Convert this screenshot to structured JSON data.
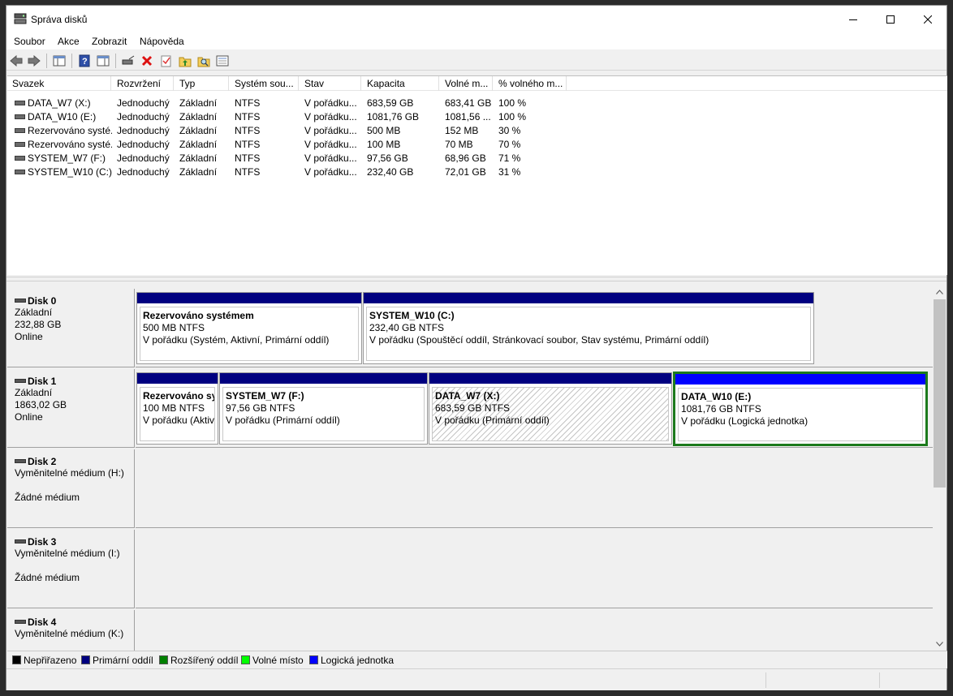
{
  "window": {
    "title": "Správa disků"
  },
  "menu": [
    "Soubor",
    "Akce",
    "Zobrazit",
    "Nápověda"
  ],
  "columns": [
    "Svazek",
    "Rozvržení",
    "Typ",
    "Systém sou...",
    "Stav",
    "Kapacita",
    "Volné m...",
    "% volného m..."
  ],
  "volumes": [
    [
      "DATA_W7 (X:)",
      "Jednoduchý",
      "Základní",
      "NTFS",
      "V pořádku...",
      "683,59 GB",
      "683,41 GB",
      "100 %"
    ],
    [
      "DATA_W10 (E:)",
      "Jednoduchý",
      "Základní",
      "NTFS",
      "V pořádku...",
      "1081,76 GB",
      "1081,56 ...",
      "100 %"
    ],
    [
      "Rezervováno systé...",
      "Jednoduchý",
      "Základní",
      "NTFS",
      "V pořádku...",
      "500 MB",
      "152 MB",
      "30 %"
    ],
    [
      "Rezervováno systé...",
      "Jednoduchý",
      "Základní",
      "NTFS",
      "V pořádku...",
      "100 MB",
      "70 MB",
      "70 %"
    ],
    [
      "SYSTEM_W7 (F:)",
      "Jednoduchý",
      "Základní",
      "NTFS",
      "V pořádku...",
      "97,56 GB",
      "68,96 GB",
      "71 %"
    ],
    [
      "SYSTEM_W10 (C:)",
      "Jednoduchý",
      "Základní",
      "NTFS",
      "V pořádku...",
      "232,40 GB",
      "72,01 GB",
      "31 %"
    ]
  ],
  "disks": [
    {
      "name": "Disk 0",
      "type": "Základní",
      "size": "232,88 GB",
      "status": "Online"
    },
    {
      "name": "Disk 1",
      "type": "Základní",
      "size": "1863,02 GB",
      "status": "Online"
    },
    {
      "name": "Disk 2",
      "type": "Vyměnitelné médium (H:)",
      "size": "",
      "status": "Žádné médium"
    },
    {
      "name": "Disk 3",
      "type": "Vyměnitelné médium (I:)",
      "size": "",
      "status": "Žádné médium"
    },
    {
      "name": "Disk 4",
      "type": "Vyměnitelné médium (K:)",
      "size": "",
      "status": ""
    }
  ],
  "partitions": {
    "d0p0": {
      "name": "Rezervováno systémem",
      "size": "500 MB NTFS",
      "status": "V pořádku (Systém, Aktivní, Primární oddíl)"
    },
    "d0p1": {
      "name": "SYSTEM_W10  (C:)",
      "size": "232,40 GB NTFS",
      "status": "V pořádku (Spouštěcí oddíl, Stránkovací soubor, Stav systému, Primární oddíl)"
    },
    "d1p0": {
      "name": "Rezervováno sy",
      "size": "100 MB NTFS",
      "status": "V pořádku (Aktiv"
    },
    "d1p1": {
      "name": "SYSTEM_W7  (F:)",
      "size": "97,56 GB NTFS",
      "status": "V pořádku (Primární oddíl)"
    },
    "d1p2": {
      "name": "DATA_W7  (X:)",
      "size": "683,59 GB NTFS",
      "status": "V pořádku (Primární oddíl)"
    },
    "d1p3": {
      "name": "DATA_W10  (E:)",
      "size": "1081,76 GB NTFS",
      "status": "V pořádku (Logická jednotka)"
    }
  },
  "legend": [
    {
      "label": "Nepřiřazeno",
      "color": "#000000"
    },
    {
      "label": "Primární oddíl",
      "color": "#000080"
    },
    {
      "label": "Rozšířený oddíl",
      "color": "#008000"
    },
    {
      "label": "Volné místo",
      "color": "#00ff00"
    },
    {
      "label": "Logická jednotka",
      "color": "#0000ff"
    }
  ]
}
